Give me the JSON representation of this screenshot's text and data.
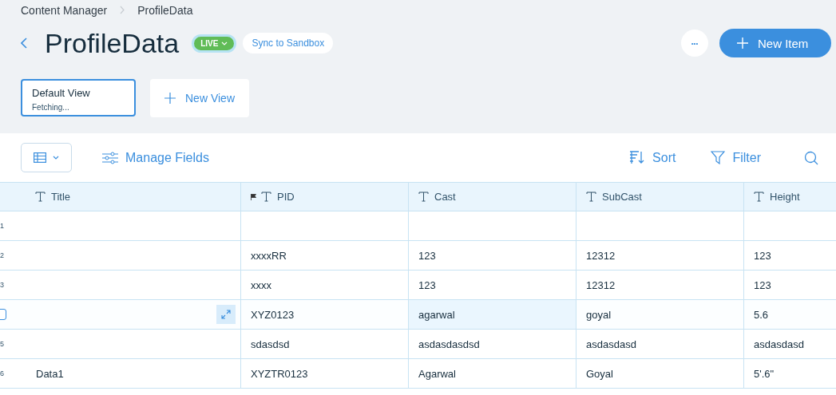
{
  "breadcrumb": [
    "Content Manager",
    "ProfileData"
  ],
  "title": "ProfileData",
  "status_badge": {
    "label": "LIVE"
  },
  "sync_button": "Sync to Sandbox",
  "more_button": "•••",
  "new_item_button": "New Item",
  "views": [
    {
      "name": "Default View",
      "status": "Fetching...",
      "selected": true
    }
  ],
  "new_view_button": "New View",
  "toolbar": {
    "manage_fields": "Manage Fields",
    "sort": "Sort",
    "filter": "Filter"
  },
  "table": {
    "columns": [
      {
        "label": "Title",
        "primary": false
      },
      {
        "label": "PID",
        "primary": true
      },
      {
        "label": "Cast",
        "primary": false
      },
      {
        "label": "SubCast",
        "primary": false
      },
      {
        "label": "Height",
        "primary": false
      }
    ],
    "rows": [
      {
        "number": "1",
        "hovered": false,
        "cells": [
          {
            "selected": false
          },
          {
            "selected": false
          },
          {
            "selected": false
          },
          {
            "selected": false
          },
          {
            "selected": false
          }
        ]
      },
      {
        "number": "2",
        "hovered": false,
        "cells": [
          {
            "selected": false
          },
          {
            "text": "xxxxRR",
            "selected": false
          },
          {
            "text": "123",
            "selected": false
          },
          {
            "text": "12312",
            "selected": false
          },
          {
            "text": "123",
            "selected": false
          }
        ]
      },
      {
        "number": "3",
        "hovered": false,
        "cells": [
          {
            "selected": false
          },
          {
            "text": "xxxx",
            "selected": false
          },
          {
            "text": "123",
            "selected": false
          },
          {
            "text": "12312",
            "selected": false
          },
          {
            "text": "123",
            "selected": false
          }
        ]
      },
      {
        "hovered": true,
        "cells": [
          {
            "selected": false
          },
          {
            "text": "XYZ0123",
            "selected": false
          },
          {
            "text": "agarwal",
            "selected": true
          },
          {
            "text": "goyal",
            "selected": false
          },
          {
            "text": "5.6",
            "selected": false
          }
        ]
      },
      {
        "number": "5",
        "hovered": false,
        "cells": [
          {
            "selected": false
          },
          {
            "text": "sdasdsd",
            "selected": false
          },
          {
            "text": "asdasdasdsd",
            "selected": false
          },
          {
            "text": "asdasdasd",
            "selected": false
          },
          {
            "text": "asdasdasd",
            "selected": false
          }
        ]
      },
      {
        "number": "6",
        "hovered": false,
        "cells": [
          {
            "text": "Data1",
            "selected": false
          },
          {
            "text": "XYZTR0123",
            "selected": false
          },
          {
            "text": "Agarwal",
            "selected": false
          },
          {
            "text": "Goyal",
            "selected": false
          },
          {
            "text": "5'.6\"",
            "selected": false
          }
        ]
      }
    ]
  }
}
